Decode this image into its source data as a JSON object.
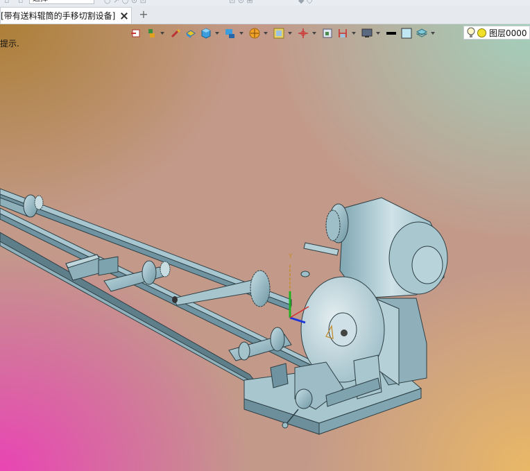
{
  "top_ribbon": {
    "combo_value": "选择"
  },
  "tab": {
    "label": "[带有送料辊筒的手移切割设备]"
  },
  "viewport": {
    "hint": "提示."
  },
  "toolbar": {
    "icons": [
      "insert-icon",
      "view-icon",
      "paint-icon",
      "render-icon",
      "cube-icon",
      "display-icon",
      "sphere-icon",
      "frame-icon",
      "csys-icon",
      "view2-icon",
      "section-icon",
      "monitor-icon",
      "line-color-icon",
      "fill-color-icon",
      "layer-stack-icon"
    ]
  },
  "layer": {
    "name": "图层0000",
    "color": "#f1e02a"
  },
  "colors": {
    "viewport_top_right": "#a2d0bc",
    "viewport_bottom_left": "#e944b4",
    "viewport_bottom_right": "#e9b866",
    "viewport_top_left": "#ad7f37",
    "model": "#8fb5c0"
  }
}
